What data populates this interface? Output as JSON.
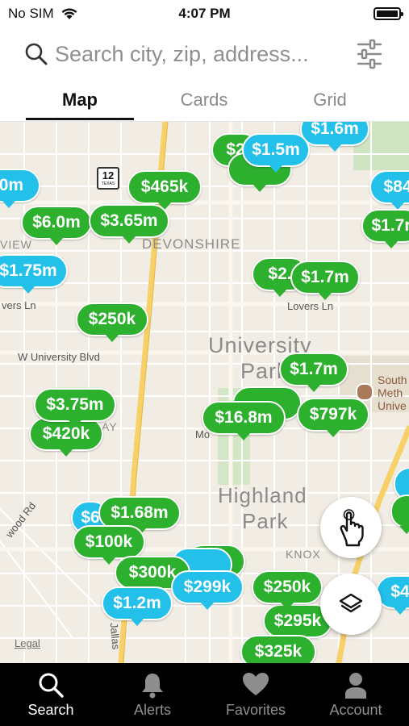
{
  "status": {
    "carrier": "No SIM",
    "time": "4:07 PM"
  },
  "search": {
    "placeholder": "Search city, zip, address..."
  },
  "tabs": [
    {
      "label": "Map"
    },
    {
      "label": "Cards"
    },
    {
      "label": "Grid"
    }
  ],
  "map": {
    "labels": {
      "highway": "12",
      "highway_sub": "TEXAS",
      "devonshire": "DEVONSHIRE",
      "view": "VIEW",
      "lovers_ln_w": "vers Ln",
      "lovers_ln_e": "Lovers Ln",
      "w_university": "W University Blvd",
      "university": "University",
      "park": "Park",
      "south": "South",
      "meth": "Meth",
      "unive": "Unive",
      "highland": "Highland",
      "park2": "Park",
      "knox": "KNOX",
      "wood_rd": "wood Rd",
      "jallas": "Jallas",
      "mo": "Mo",
      "ay": "AY"
    },
    "pins": [
      {
        "price": "$1.6m",
        "color": "blue"
      },
      {
        "price": "$1.5m",
        "color": "blue"
      },
      {
        "price": "$2",
        "color": "green"
      },
      {
        "price": "$465k",
        "color": "green"
      },
      {
        "price": ".0m",
        "color": "blue"
      },
      {
        "price": "$84",
        "color": "blue"
      },
      {
        "price": "$6.0m",
        "color": "green"
      },
      {
        "price": "$3.65m",
        "color": "green"
      },
      {
        "price": "$1.7r",
        "color": "green"
      },
      {
        "price": "$1.75m",
        "color": "blue"
      },
      {
        "price": "$2.",
        "color": "green"
      },
      {
        "price": "$1.7m",
        "color": "green"
      },
      {
        "price": "$250k",
        "color": "green"
      },
      {
        "price": "$1.7m",
        "color": "green"
      },
      {
        "price": "$3.75m",
        "color": "green"
      },
      {
        "price": "$16.8m",
        "color": "green"
      },
      {
        "price": "$797k",
        "color": "green"
      },
      {
        "price": "$420k",
        "color": "green"
      },
      {
        "price": "$1.68m",
        "color": "green"
      },
      {
        "price": "$6",
        "color": "blue"
      },
      {
        "price": "$100k",
        "color": "green"
      },
      {
        "price": "$300k",
        "color": "green"
      },
      {
        "price": "$299k",
        "color": "blue"
      },
      {
        "price": "$1.2m",
        "color": "blue"
      },
      {
        "price": "$250k",
        "color": "green"
      },
      {
        "price": "$295k",
        "color": "green"
      },
      {
        "price": "$4",
        "color": "blue"
      },
      {
        "price": "$325k",
        "color": "green"
      }
    ],
    "legal": "Legal"
  },
  "colors": {
    "green_pin": "#2db02e",
    "blue_pin": "#23c0ea",
    "tab_bar": "#000000"
  },
  "bottom_tabs": [
    {
      "label": "Search",
      "icon": "search-icon"
    },
    {
      "label": "Alerts",
      "icon": "bell-icon"
    },
    {
      "label": "Favorites",
      "icon": "heart-icon"
    },
    {
      "label": "Account",
      "icon": "person-icon"
    }
  ]
}
